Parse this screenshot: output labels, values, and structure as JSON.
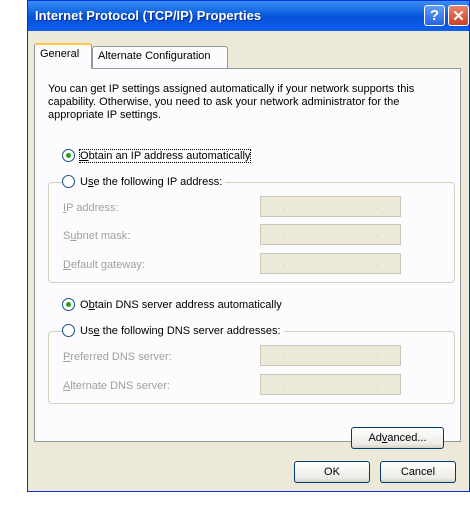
{
  "window": {
    "title": "Internet Protocol (TCP/IP) Properties",
    "help_glyph": "?",
    "close_glyph": "✕"
  },
  "tabs": [
    {
      "label": "General"
    },
    {
      "label": "Alternate Configuration"
    }
  ],
  "description": "You can get IP settings assigned automatically if your network supports this capability. Otherwise, you need to ask your network administrator for the appropriate IP settings.",
  "ip_section": {
    "auto_option": {
      "pre": "",
      "key": "O",
      "post": "btain an IP address automatically",
      "checked": true
    },
    "manual_option": {
      "pre": "U",
      "key": "s",
      "post": "e the following IP address:",
      "checked": false
    },
    "fields": [
      {
        "pre": "",
        "key": "I",
        "post": "P address:",
        "value": ""
      },
      {
        "pre": "S",
        "key": "u",
        "post": "bnet mask:",
        "value": ""
      },
      {
        "pre": "",
        "key": "D",
        "post": "efault gateway:",
        "value": ""
      }
    ]
  },
  "dns_section": {
    "auto_option": {
      "pre": "O",
      "key": "b",
      "post": "tain DNS server address automatically",
      "checked": true
    },
    "manual_option": {
      "pre": "Us",
      "key": "e",
      "post": " the following DNS server addresses:",
      "checked": false
    },
    "fields": [
      {
        "pre": "",
        "key": "P",
        "post": "referred DNS server:",
        "value": ""
      },
      {
        "pre": "",
        "key": "A",
        "post": "lternate DNS server:",
        "value": ""
      }
    ]
  },
  "buttons": {
    "advanced": {
      "pre": "Ad",
      "key": "v",
      "post": "anced..."
    },
    "ok": "OK",
    "cancel": "Cancel"
  },
  "colors": {
    "titlebar": "#0a5fe0",
    "dialog_bg": "#ece9d8",
    "radio_dot": "#21a121",
    "tab_highlight": "#ffc83c"
  }
}
